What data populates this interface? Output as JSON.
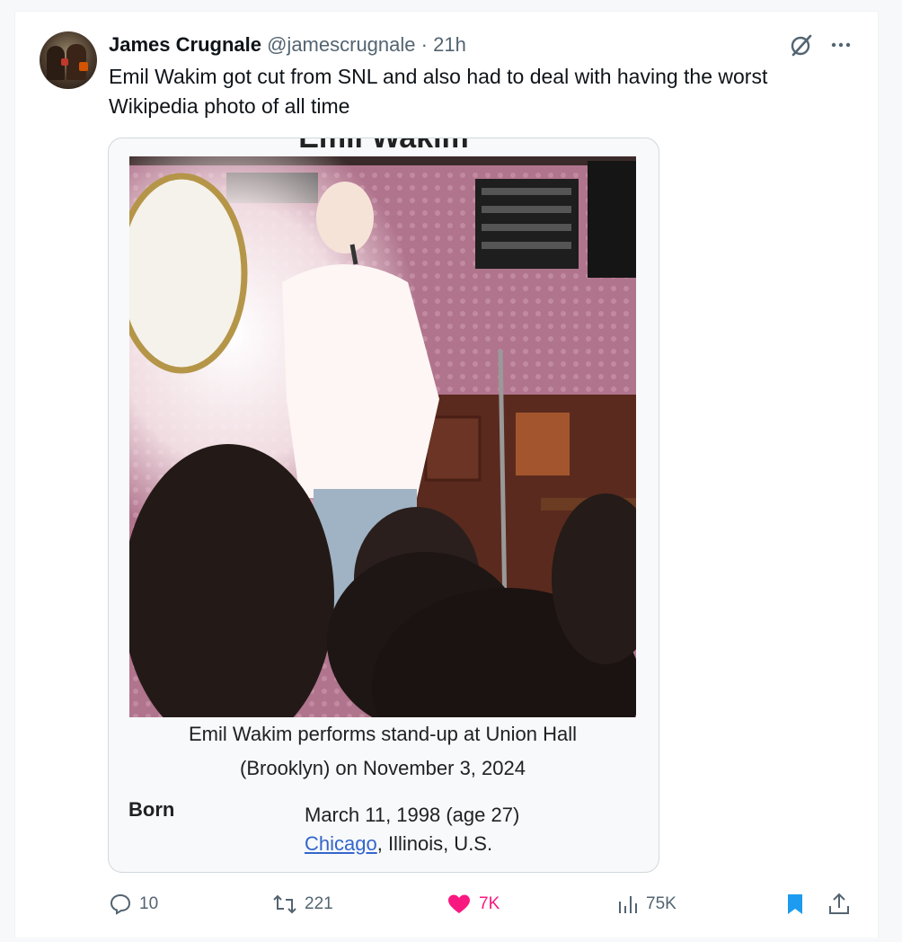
{
  "tweet": {
    "author_name": "James Crugnale",
    "author_handle": "@jamescrugnale",
    "separator": "·",
    "time": "21h",
    "text": "Emil Wakim got cut from SNL and also had to deal with having the worst Wikipedia photo of all time"
  },
  "media": {
    "page_title_partial": "Emil Wakim",
    "caption_line1": "Emil Wakim performs stand-up at Union Hall",
    "caption_line2": "(Brooklyn) on November 3, 2024",
    "born_label": "Born",
    "born_date": "March 11, 1998 (age 27)",
    "born_city": "Chicago",
    "born_rest": ", Illinois, U.S."
  },
  "actions": {
    "replies": "10",
    "reposts": "221",
    "likes": "7K",
    "views": "75K"
  },
  "icons": {
    "grok": "grok-icon",
    "more": "more-icon",
    "reply": "reply-icon",
    "repost": "repost-icon",
    "like": "heart-icon",
    "views": "views-icon",
    "bookmark": "bookmark-icon",
    "share": "share-icon"
  },
  "colors": {
    "like_active": "#f91880",
    "bookmark_active": "#1d9bf0",
    "text_secondary": "#536471",
    "wiki_link": "#3366cc"
  }
}
